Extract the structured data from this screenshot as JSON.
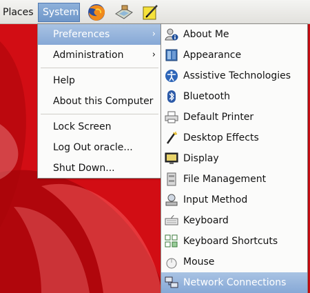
{
  "panel": {
    "places_label": "Places",
    "system_label": "System",
    "launchers": [
      "firefox-icon",
      "network-places-icon",
      "note-editor-icon"
    ]
  },
  "system_menu": {
    "items": [
      {
        "label": "Preferences",
        "submenu": true,
        "highlighted": true
      },
      {
        "label": "Administration",
        "submenu": true
      },
      {
        "label": "Help"
      },
      {
        "label": "About this Computer"
      },
      {
        "label": "Lock Screen"
      },
      {
        "label": "Log Out oracle..."
      },
      {
        "label": "Shut Down..."
      }
    ],
    "submenu_arrow": "›"
  },
  "preferences_menu": {
    "items": [
      {
        "label": "About Me",
        "icon": "about-me-icon"
      },
      {
        "label": "Appearance",
        "icon": "appearance-icon"
      },
      {
        "label": "Assistive Technologies",
        "icon": "accessibility-icon"
      },
      {
        "label": "Bluetooth",
        "icon": "bluetooth-icon"
      },
      {
        "label": "Default Printer",
        "icon": "printer-icon"
      },
      {
        "label": "Desktop Effects",
        "icon": "desktop-effects-icon"
      },
      {
        "label": "Display",
        "icon": "display-icon"
      },
      {
        "label": "File Management",
        "icon": "file-management-icon"
      },
      {
        "label": "Input Method",
        "icon": "input-method-icon"
      },
      {
        "label": "Keyboard",
        "icon": "keyboard-icon"
      },
      {
        "label": "Keyboard Shortcuts",
        "icon": "keyboard-shortcuts-icon"
      },
      {
        "label": "Mouse",
        "icon": "mouse-icon"
      },
      {
        "label": "Network Connections",
        "icon": "network-connections-icon",
        "highlighted": true
      }
    ]
  },
  "colors": {
    "wallpaper_red": "#d40f16",
    "highlight_blue": "#86a8d6"
  }
}
